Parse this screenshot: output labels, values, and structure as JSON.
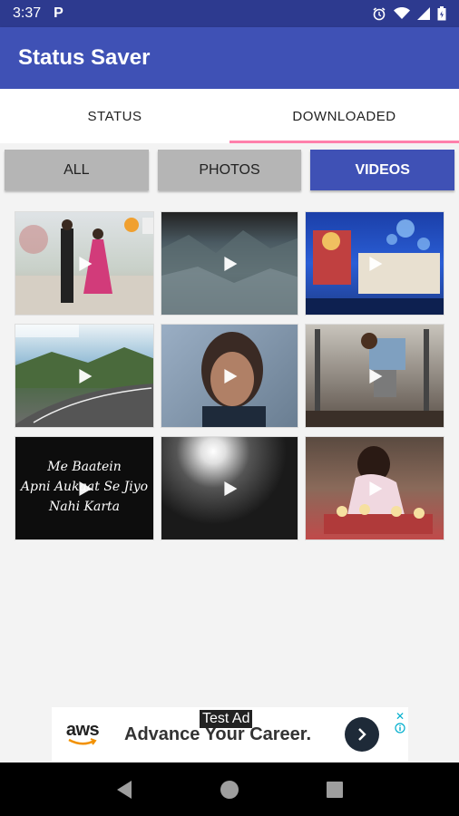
{
  "status_bar": {
    "time": "3:37",
    "app_indicator": "P"
  },
  "app_bar": {
    "title": "Status Saver"
  },
  "tabs": [
    {
      "label": "STATUS",
      "active": false
    },
    {
      "label": "DOWNLOADED",
      "active": true
    }
  ],
  "filters": [
    {
      "label": "ALL",
      "active": false
    },
    {
      "label": "PHOTOS",
      "active": false
    },
    {
      "label": "VIDEOS",
      "active": true
    }
  ],
  "thumb_text": "Me Baatein\nApni Aukaat Se Jiyo\nNahi Karta",
  "ad": {
    "badge": "Test Ad",
    "brand": "aws",
    "headline": "Advance Your Career.",
    "close": "✕"
  },
  "colors": {
    "primary": "#3f51b5",
    "primary_dark": "#2d3a8f",
    "accent": "#ff80ab"
  }
}
